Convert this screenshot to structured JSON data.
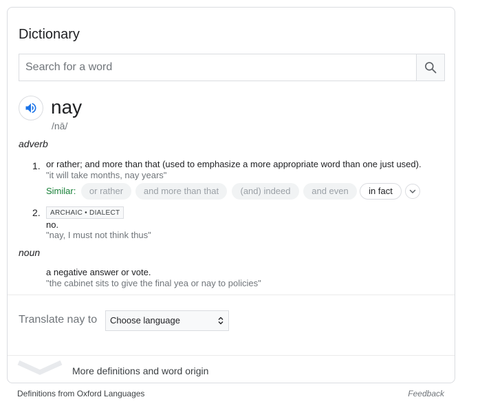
{
  "card": {
    "title": "Dictionary"
  },
  "search": {
    "placeholder": "Search for a word",
    "value": ""
  },
  "entry": {
    "word": "nay",
    "phonetic": "/nā/"
  },
  "adverb": {
    "pos": "adverb",
    "senses": [
      {
        "number": "1.",
        "definition": "or rather; and more than that (used to emphasize a more appropriate word than one just used).",
        "example": "\"it will take months, nay years\"",
        "similar_label": "Similar:",
        "similar": [
          "or rather",
          "and more than that",
          "(and) indeed",
          "and even",
          "in fact"
        ]
      },
      {
        "number": "2.",
        "tag": "ARCHAIC • DIALECT",
        "definition": "no.",
        "example": "\"nay, I must not think thus\""
      }
    ]
  },
  "noun": {
    "pos": "noun",
    "definition": "a negative answer or vote.",
    "example": "\"the cabinet sits to give the final yea or nay to policies\""
  },
  "translate": {
    "label": "Translate nay to",
    "selected": "Choose language"
  },
  "more": {
    "label": "More definitions and word origin"
  },
  "footer": {
    "source": "Definitions from Oxford Languages",
    "feedback": "Feedback"
  },
  "colors": {
    "accent_blue": "#1a73e8",
    "similar_green": "#188038",
    "border": "#dadce0"
  }
}
